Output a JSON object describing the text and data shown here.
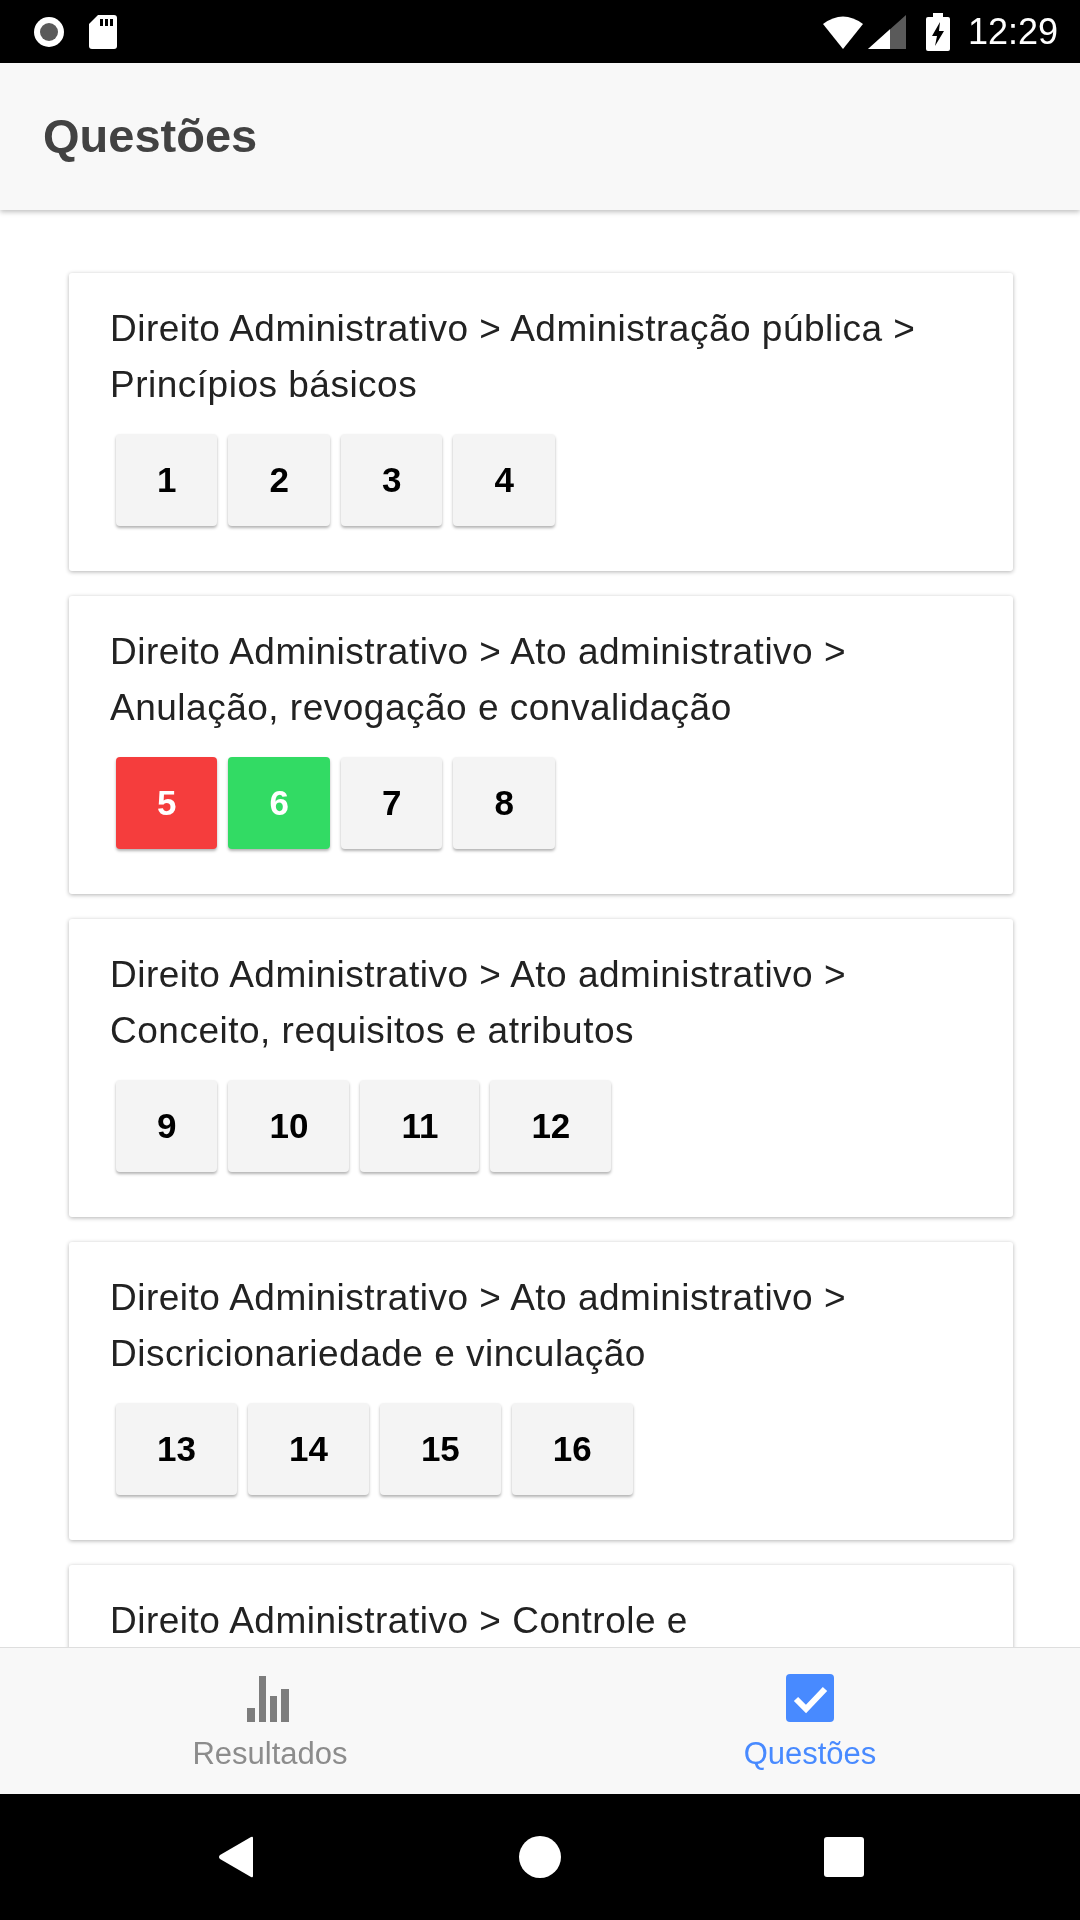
{
  "status_bar": {
    "time": "12:29"
  },
  "header": {
    "title": "Questões"
  },
  "cards": [
    {
      "title": "Direito Administrativo > Administração pública > Princípios básicos",
      "questions": [
        {
          "number": "1",
          "color": "#f4f4f4"
        },
        {
          "number": "2",
          "color": "#f4f4f4"
        },
        {
          "number": "3",
          "color": "#f4f4f4"
        },
        {
          "number": "4",
          "color": "#f4f4f4"
        }
      ]
    },
    {
      "title": "Direito Administrativo > Ato administrativo > Anulação, revogação e convalidação",
      "questions": [
        {
          "number": "5",
          "color": "#f53d3d"
        },
        {
          "number": "6",
          "color": "#32db64"
        },
        {
          "number": "7",
          "color": "#f4f4f4"
        },
        {
          "number": "8",
          "color": "#f4f4f4"
        }
      ]
    },
    {
      "title": "Direito Administrativo > Ato administrativo > Conceito, requisitos e atributos",
      "questions": [
        {
          "number": "9",
          "color": "#f4f4f4"
        },
        {
          "number": "10",
          "color": "#f4f4f4"
        },
        {
          "number": "11",
          "color": "#f4f4f4"
        },
        {
          "number": "12",
          "color": "#f4f4f4"
        }
      ]
    },
    {
      "title": "Direito Administrativo > Ato administrativo > Discricionariedade e vinculação",
      "questions": [
        {
          "number": "13",
          "color": "#f4f4f4"
        },
        {
          "number": "14",
          "color": "#f4f4f4"
        },
        {
          "number": "15",
          "color": "#f4f4f4"
        },
        {
          "number": "16",
          "color": "#f4f4f4"
        }
      ]
    },
    {
      "title": "Direito Administrativo > Controle e"
    }
  ],
  "tabs": [
    {
      "label": "Resultados",
      "selected": false
    },
    {
      "label": "Questões",
      "selected": true
    }
  ]
}
